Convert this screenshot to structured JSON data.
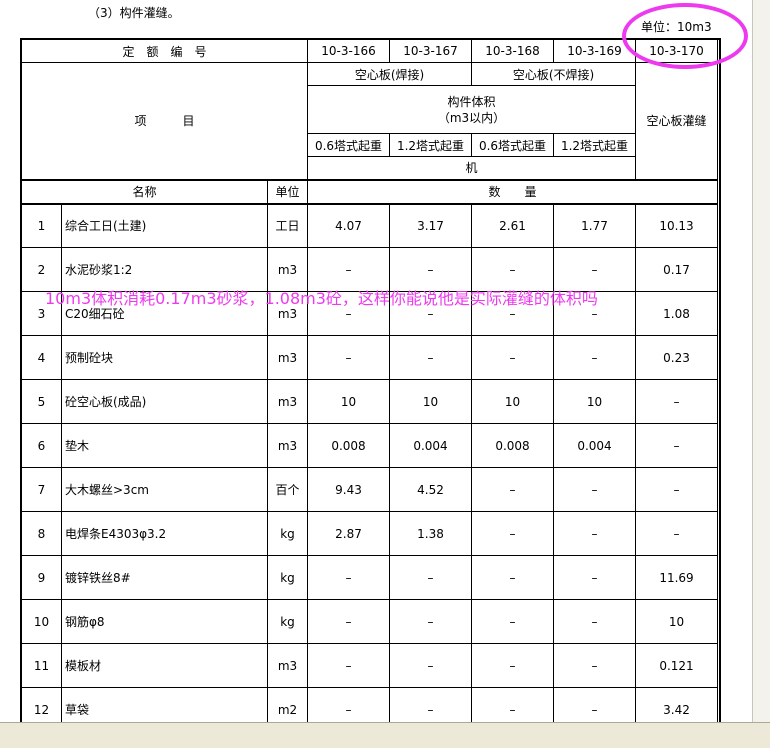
{
  "section_title": "（3）构件灌缝。",
  "unit_label": "单位：10m3",
  "header": {
    "quota_number_label": "定　额　编　号",
    "codes": [
      "10-3-166",
      "10-3-167",
      "10-3-168",
      "10-3-169",
      "10-3-170"
    ],
    "item_label": "项　　　目",
    "group_welded": "空心板(焊接)",
    "group_unwelded": "空心板(不焊接)",
    "component_volume_line1": "构件体积",
    "component_volume_line2": "（m3以内）",
    "crane_types": [
      "0.6塔式起重",
      "1.2塔式起重",
      "0.6塔式起重",
      "1.2塔式起重"
    ],
    "machine_label": "机",
    "grouting_label": "空心板灌缝",
    "name_col": "名称",
    "unit_col": "单位",
    "quantity_col": "数　　量"
  },
  "rows": [
    {
      "no": "1",
      "name": "综合工日(土建)",
      "unit": "工日",
      "values": [
        "4.07",
        "3.17",
        "2.61",
        "1.77",
        "10.13"
      ]
    },
    {
      "no": "2",
      "name": "水泥砂浆1:2",
      "unit": "m3",
      "values": [
        "–",
        "–",
        "–",
        "–",
        "0.17"
      ]
    },
    {
      "no": "3",
      "name": "C20细石砼",
      "unit": "m3",
      "values": [
        "–",
        "–",
        "–",
        "–",
        "1.08"
      ]
    },
    {
      "no": "4",
      "name": "预制砼块",
      "unit": "m3",
      "values": [
        "–",
        "–",
        "–",
        "–",
        "0.23"
      ]
    },
    {
      "no": "5",
      "name": "砼空心板(成品)",
      "unit": "m3",
      "values": [
        "10",
        "10",
        "10",
        "10",
        "–"
      ]
    },
    {
      "no": "6",
      "name": "垫木",
      "unit": "m3",
      "values": [
        "0.008",
        "0.004",
        "0.008",
        "0.004",
        "–"
      ]
    },
    {
      "no": "7",
      "name": "大木螺丝>3cm",
      "unit": "百个",
      "values": [
        "9.43",
        "4.52",
        "–",
        "–",
        "–"
      ]
    },
    {
      "no": "8",
      "name": "电焊条E4303φ3.2",
      "unit": "kg",
      "values": [
        "2.87",
        "1.38",
        "–",
        "–",
        "–"
      ]
    },
    {
      "no": "9",
      "name": "镀锌铁丝8#",
      "unit": "kg",
      "values": [
        "–",
        "–",
        "–",
        "–",
        "11.69"
      ]
    },
    {
      "no": "10",
      "name": "钢筋φ8",
      "unit": "kg",
      "values": [
        "–",
        "–",
        "–",
        "–",
        "10"
      ]
    },
    {
      "no": "11",
      "name": "模板材",
      "unit": "m3",
      "values": [
        "–",
        "–",
        "–",
        "–",
        "0.121"
      ]
    },
    {
      "no": "12",
      "name": "草袋",
      "unit": "m2",
      "values": [
        "–",
        "–",
        "–",
        "–",
        "3.42"
      ]
    }
  ],
  "annotation": "10m3体积消耗0.17m3砂浆，1.08m3砼，这样你能说他是实际灌缝的体积吗",
  "colors": {
    "annotation": "#ee3aee",
    "window_bg": "#ece9d8",
    "page_bg": "#ffffff"
  }
}
